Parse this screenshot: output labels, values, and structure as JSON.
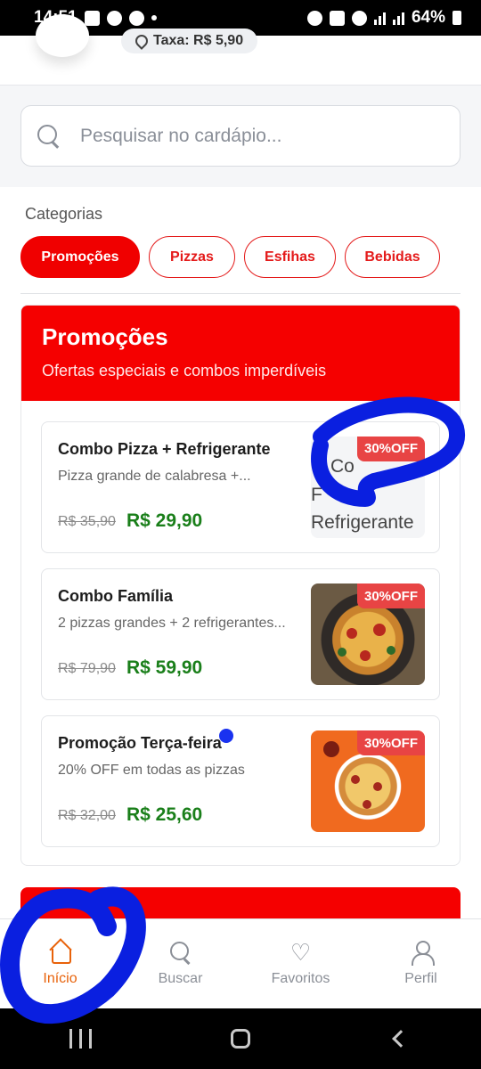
{
  "status_bar": {
    "time": "14:51",
    "battery": "64%"
  },
  "header": {
    "fee_label": "Taxa: R$ 5,90"
  },
  "search": {
    "placeholder": "Pesquisar no cardápio..."
  },
  "categories": {
    "title": "Categorias",
    "items": [
      {
        "label": "Promoções",
        "active": true
      },
      {
        "label": "Pizzas",
        "active": false
      },
      {
        "label": "Esfihas",
        "active": false
      },
      {
        "label": "Bebidas",
        "active": false
      }
    ]
  },
  "promo_section": {
    "title": "Promoções",
    "subtitle": "Ofertas especiais e combos imperdíveis",
    "cards": [
      {
        "name": "Combo Pizza + Refrigerante",
        "description": "Pizza grande de calabresa +...",
        "old_price": "R$ 35,90",
        "price": "R$ 29,90",
        "badge": "30%OFF",
        "image_alt_lines": [
          "Co",
          "F",
          "Refrigerante"
        ]
      },
      {
        "name": "Combo Família",
        "description": "2 pizzas grandes + 2 refrigerantes...",
        "old_price": "R$ 79,90",
        "price": "R$ 59,90",
        "badge": "30%OFF"
      },
      {
        "name": "Promoção Terça-feira",
        "description": "20% OFF em todas as pizzas",
        "old_price": "R$ 32,00",
        "price": "R$ 25,60",
        "badge": "30%OFF"
      }
    ]
  },
  "bottom_nav": {
    "items": [
      {
        "label": "Início",
        "icon": "home-icon",
        "active": true
      },
      {
        "label": "Buscar",
        "icon": "search-icon",
        "active": false
      },
      {
        "label": "Favoritos",
        "icon": "heart-icon",
        "active": false
      },
      {
        "label": "Perfil",
        "icon": "user-icon",
        "active": false
      }
    ]
  },
  "colors": {
    "brand_red": "#f50000",
    "price_green": "#1a7f1a",
    "active_nav": "#e8620a",
    "annotation_blue": "#0a1fe0"
  }
}
